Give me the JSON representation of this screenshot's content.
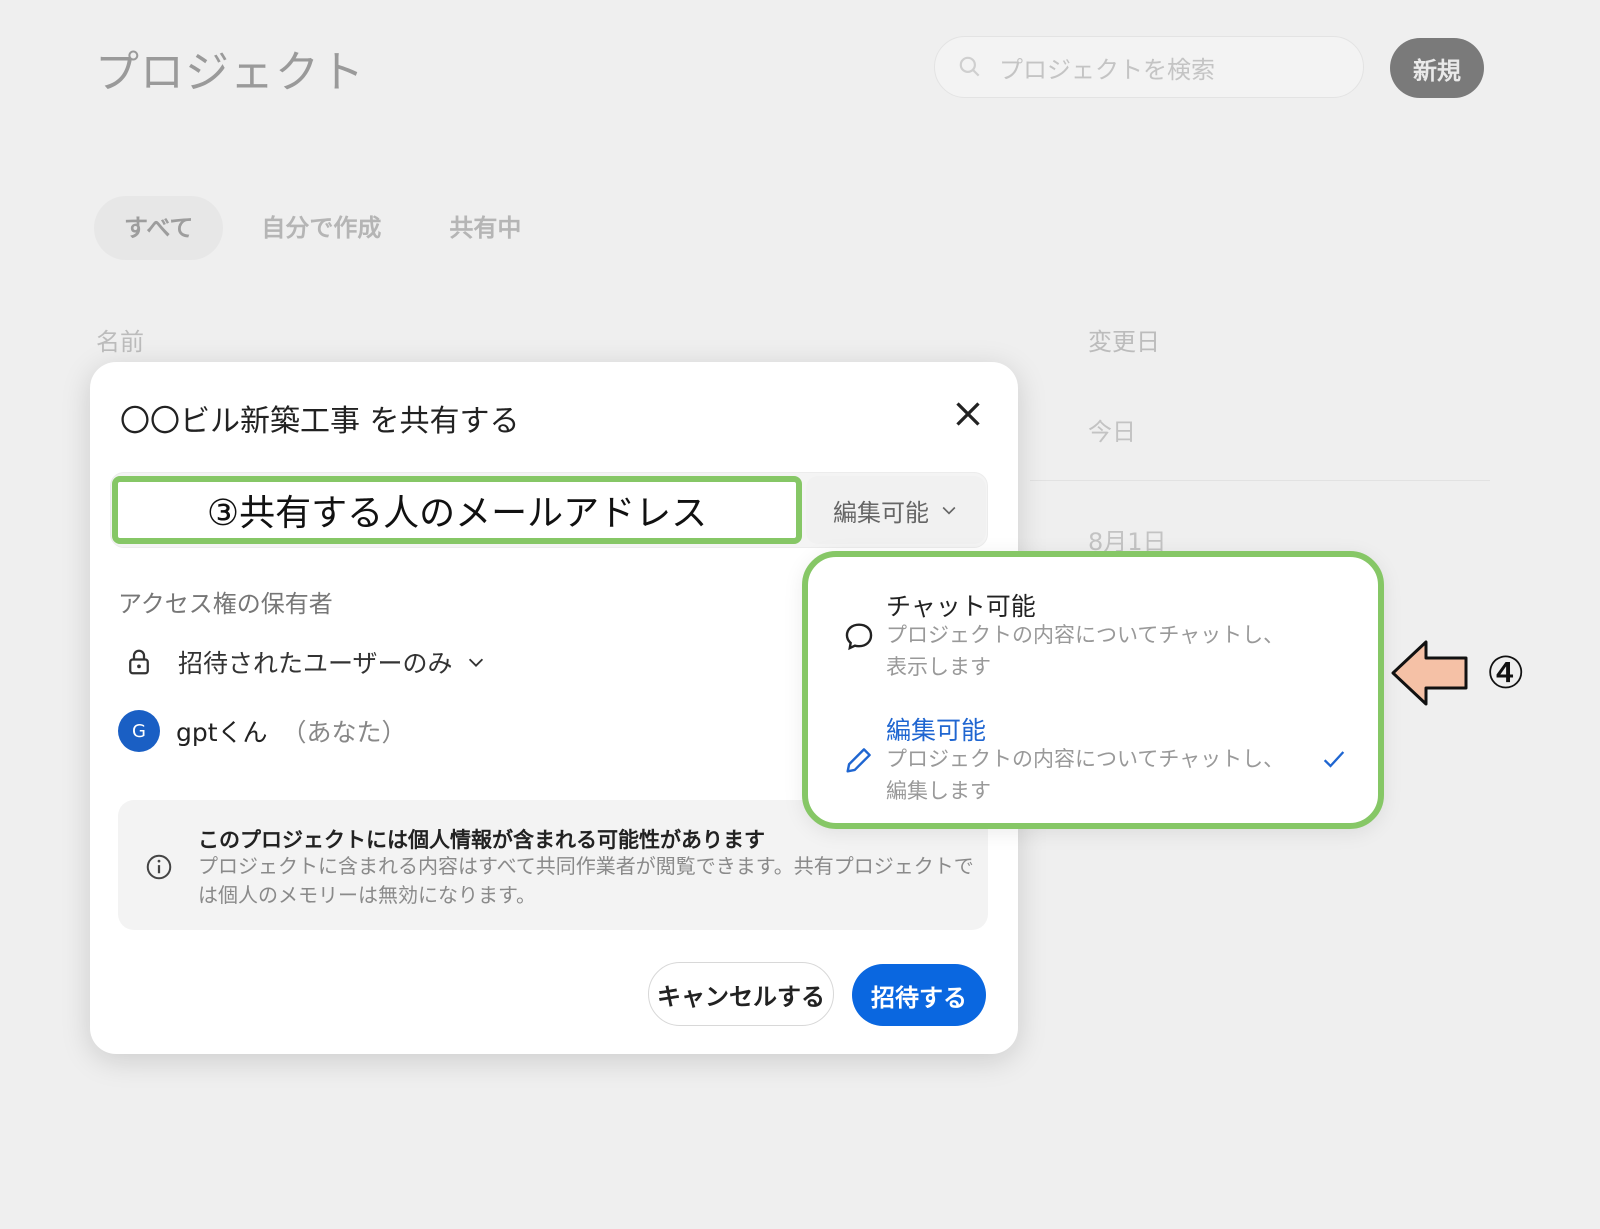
{
  "page": {
    "title": "プロジェクト",
    "search_placeholder": "プロジェクトを検索",
    "new_button": "新規",
    "tabs": [
      {
        "label": "すべて",
        "active": true
      },
      {
        "label": "自分で作成",
        "active": false
      },
      {
        "label": "共有中",
        "active": false
      }
    ],
    "columns": {
      "name": "名前",
      "modified": "変更日"
    },
    "rows": [
      {
        "modified": "今日"
      },
      {
        "modified": "8月1日"
      }
    ]
  },
  "modal": {
    "title": "〇〇ビル新築工事 を共有する",
    "email_annotation": "③共有する人のメールアドレス",
    "permission_selected": "編集可能",
    "access_label": "アクセス権の保有者",
    "access_scope": "招待されたユーザーのみ",
    "user": {
      "initial": "G",
      "name": "gptくん",
      "you": "（あなた）"
    },
    "info": {
      "title": "このプロジェクトには個人情報が含まれる可能性があります",
      "body": "プロジェクトに含まれる内容はすべて共同作業者が閲覧できます。共有プロジェクトでは個人のメモリーは無効になります。"
    },
    "cancel_button": "キャンセルする",
    "invite_button": "招待する"
  },
  "dropdown": {
    "options": [
      {
        "title": "チャット可能",
        "desc": "プロジェクトの内容についてチャットし、表示します",
        "icon": "chat-bubble-icon",
        "selected": false
      },
      {
        "title": "編集可能",
        "desc": "プロジェクトの内容についてチャットし、編集します",
        "icon": "pencil-icon",
        "selected": true
      }
    ]
  },
  "annotation": {
    "step_label": "④",
    "arrow_color": "#f5c1a6",
    "callout_color": "#86c766"
  },
  "colors": {
    "accent": "#0a67e0",
    "selected_text": "#1f66d1",
    "avatar": "#1a5fc4"
  }
}
